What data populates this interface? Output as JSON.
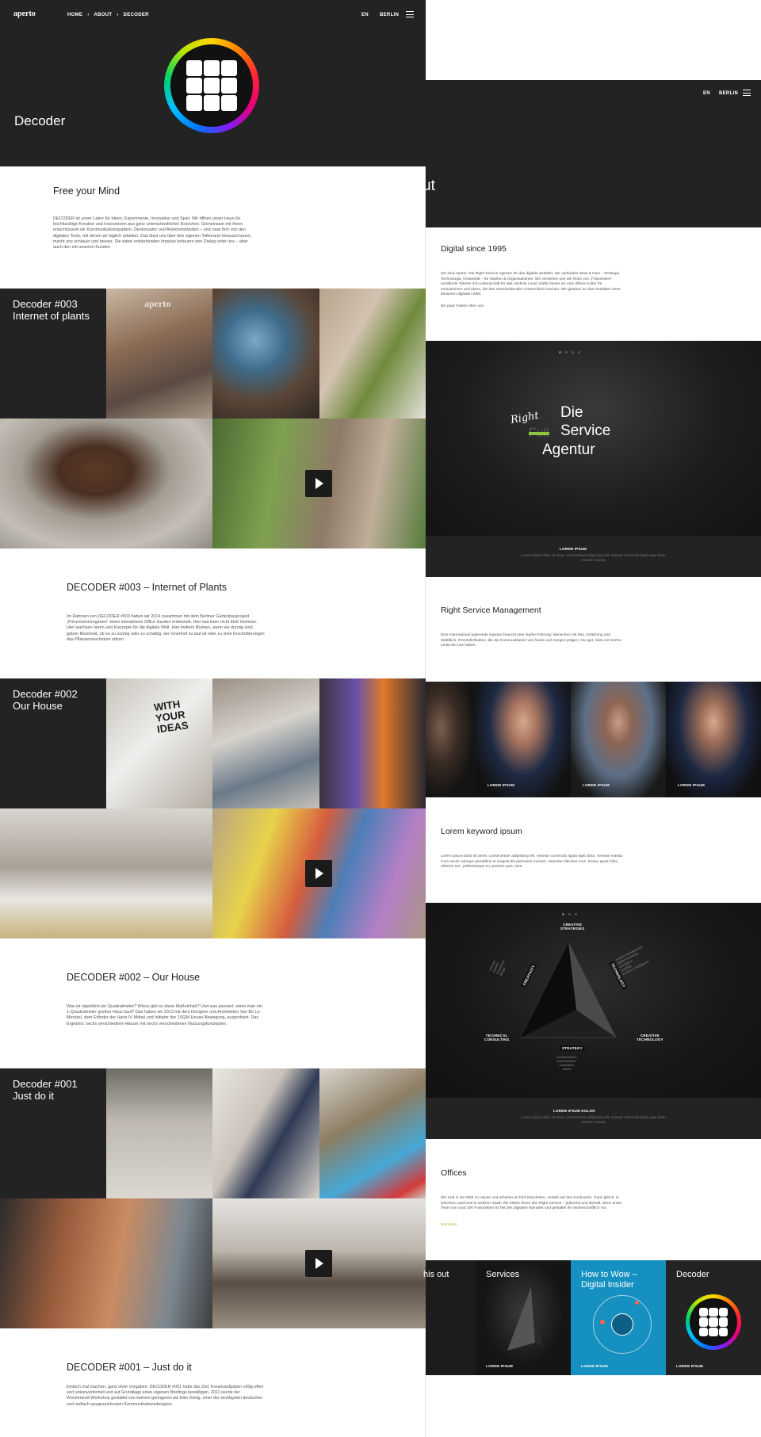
{
  "left": {
    "logo": "aperto",
    "breadcrumb": [
      "HOME",
      "ABOUT",
      "DECODER"
    ],
    "lang": "EN",
    "city": "BERLIN",
    "hero_title": "Decoder",
    "intro": {
      "title": "Free your Mind",
      "text": "DECODER ist unser Labor für Ideen, Experimente, Innovation und Spiel. Wir öffnen unser Haus für hochkarätige Kreative und Innovatoren aus ganz unterschiedlichen Branchen. Gemeinsam mit ihnen entschlüsseln wir Kommunikationspattern, Denkmuster und Arbeitsmethoden – und zwar fern von den digitalen Tools, mit denen wir täglich arbeiten. Das lässt uns über den eigenen Tellerrand hinausschauen, macht uns schlauer und besser. Die dabei entstehenden Impulse befeuern den Dialog unter uns – aber auch den mit unseren Kunden."
    },
    "projects": [
      {
        "tile": "Decoder #003\nInternet of plants",
        "title": "DECODER #003 – Internet of Plants",
        "text": "Im Rahmen von DECODER #003 haben wir 2014 zusammen mit dem Berliner Gartenbauprojekt „Prinzessinnengärten“ einen interaktiven Office Garden entwickelt. Hier wachsen nicht bloß Gemüse. Hier wachsen Ideen und Konzepte für die digitale Welt. Hier twittern Blumen, wenn sie durstig sind, geben Bescheid, ob es zu sonnig oder zu schattig, der Innenhof zu laut ist oder zu viele Erschütterungen das Pflanzenwachstum stören."
      },
      {
        "tile": "Decoder #002\nOur House",
        "title": "DECODER #002 – Our House",
        "text": "Was ist eigentlich ein Quadratmeter? Wieso gibt es diese Maßeinheit? Und was passiert, wenn man ein 1-Quadratmeter großes Haus baut? Das haben wir 2013 mit dem Designer und Architekten Van Bo Le-Mentzel, dem Erfinder der Hartz IV Möbel und Initiator der 1SQM-House-Bewegung, ausprobiert. Das Ergebnis: sechs verschiedene Häuser mit sechs verschiedenen Nutzungskonzepten."
      },
      {
        "tile": "Decoder #001\nJust do it",
        "title": "DECODER #001 – Just do it",
        "text": "Einfach mal machen, ganz ohne Vorgaben: DECODER #001 hatte das Ziel, Kreativaufgaben völlig offen und unkonventionell und auf Grundlage eines eigenen Briefings bewältigen. 2011 wurde der Wochenend-Workshop gestaltet von keinem geringeren als Eike König, einer der wichtigsten deutschen und vielfach ausgezeichneten Kommunikationsdesigner."
      }
    ],
    "photo_watermark": "aperto",
    "sign_text": "WITH YOUR IDEAS"
  },
  "right": {
    "lang": "EN",
    "city": "BERLIN",
    "hero_fragment": "ut",
    "digital": {
      "title": "Digital since 1995",
      "text": "Wir sind Aperto. Die Right Service Agentur für das digitale Zeitalter. Wir verbinden Wow & How – Strategie, Technologie, Kreativität – für Marken & Organisationen. Wir verstehen uns als Team von „Fusionisten“: exzellente Talente mit Leidenschaft für das nächste Level. Dafür bieten wir eine offene Kultur für Innovationen und Ideen, die den entscheidenden Unterschied machen. Wir glauben an das Gestalten einer besseren digitalen Welt.",
      "link": "Ein paar Fakten über uns"
    },
    "slide1": {
      "script": "Right",
      "strike": "Full",
      "line1": "Die",
      "line2": "Service",
      "line3": "Agentur",
      "caption_title": "LOREM IPSUM",
      "caption_text": "Lorem ipsum dolor sit amet, consectetuer adipiscing elit. Aenean commodo ligula eget dolor. Aenean massa."
    },
    "rsm": {
      "title": "Right Service Management",
      "text": "Eine international agierende Agentur braucht eine starke Führung: Menschen mit Mut, Erfahrung und Weitblick. Persönlichkeiten, die die Kommunikation von heute und morgen prägen. Nur gut, dass wir solche Leute bei uns haben."
    },
    "people_label": "LOREM IPSUM",
    "keyword": {
      "title": "Lorem keyword ipsum",
      "text": "Lorem ipsum dolor sit amet, consectetuer adipiscing elit. Aenean commodo ligula eget dolor. Aenean massa. Cum sociis natoque penatibus et magnis dis parturient montes, nascetur ridiculus mus. Donec quam felis, ultricies nec, pellentesque eu, pretium quis, sem."
    },
    "slide2": {
      "top": "CREATIVE\nSTRATEGIES",
      "left_label": "CREATIVITY",
      "right_label": "TECHNOLOGY",
      "bottom_label": "STRATEGY",
      "left_words": "concept\ncontent\nexperience\ndesign",
      "right_words": "content management\ndigital marketing\ncommerce\nusability\nbusiness intelligence",
      "bottom_words": "transformation\nperformance\ninnovation\nbrand",
      "corner_left": "TECHNICAL\nCONSULTING",
      "corner_right": "CREATIVE\nTECHNOLOGY",
      "caption_title": "LOREM IPSUM DOLOR",
      "caption_text": "Lorem ipsum dolor sit amet, consectetuer adipiscing elit. Aenean commodo ligula eget dolor. Aenean massa."
    },
    "offices": {
      "title": "Offices",
      "text": "Wir sind in der Welt zu Hause und arbeiten an fünf Standorten, verteilt auf drei Kontinente. Ganz gleich, in welchem Land und in welcher Stadt: Wir bieten Ihnen den Right Service – jederzeit und überall. Denn unser Team von rund 400 Fusionisten ist Teil des digitalen Wandels und gestaltet ihn leidenschaftlich mit.",
      "link": "Standorte"
    },
    "teasers": [
      {
        "title": "his out",
        "label": ""
      },
      {
        "title": "Services",
        "label": "LOREM IPSUM"
      },
      {
        "title": "How to Wow –\nDigital Insider",
        "label": "LOREM IPSUM"
      },
      {
        "title": "Decoder",
        "label": "LOREM IPSUM"
      }
    ]
  },
  "colors": {
    "dark": "#232323",
    "accent_green": "#8cc63f",
    "teal": "#1590c0"
  }
}
